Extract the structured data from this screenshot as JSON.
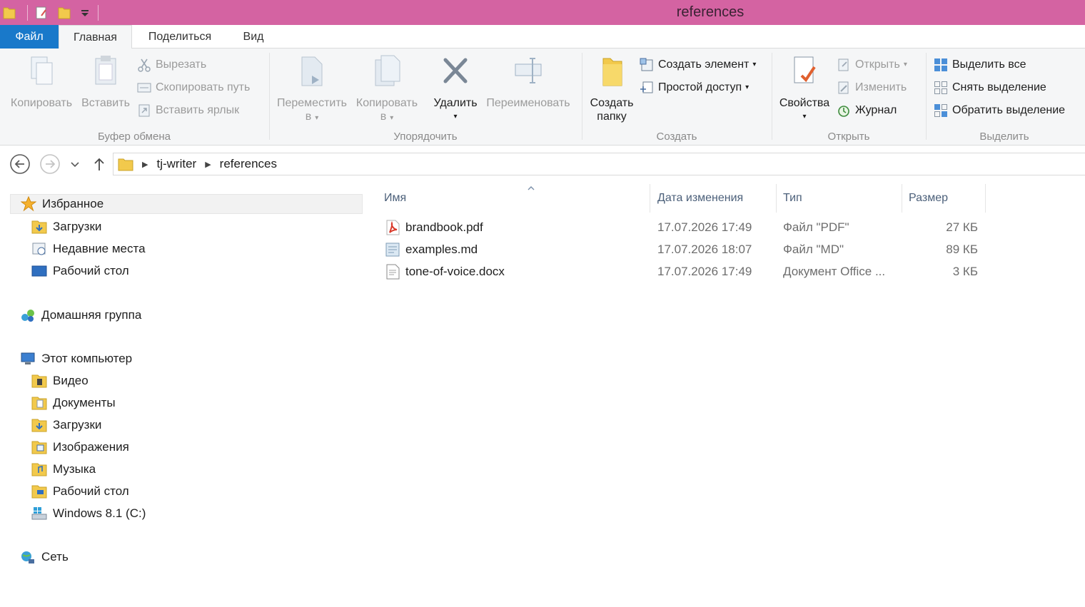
{
  "window": {
    "title": "references",
    "titlebar_color": "#d463a2"
  },
  "quick_access": {
    "icons": [
      "folder-icon",
      "properties-icon",
      "new-folder-icon",
      "customize-dropdown-icon"
    ]
  },
  "ribbon_tabs": {
    "file": "Файл",
    "home": "Главная",
    "share": "Поделиться",
    "view": "Вид"
  },
  "ribbon": {
    "clipboard": {
      "label": "Буфер обмена",
      "copy": "Копировать",
      "paste": "Вставить",
      "cut": "Вырезать",
      "copy_path": "Скопировать путь",
      "paste_shortcut": "Вставить ярлык"
    },
    "organize": {
      "label": "Упорядочить",
      "move_to_1": "Переместить",
      "move_to_2": "в",
      "copy_to_1": "Копировать",
      "copy_to_2": "в",
      "delete": "Удалить",
      "rename": "Переименовать"
    },
    "new": {
      "label": "Создать",
      "new_folder_1": "Создать",
      "new_folder_2": "папку",
      "new_item": "Создать элемент",
      "easy_access": "Простой доступ"
    },
    "open": {
      "label": "Открыть",
      "properties": "Свойства",
      "open": "Открыть",
      "edit": "Изменить",
      "history": "Журнал"
    },
    "select": {
      "label": "Выделить",
      "select_all": "Выделить все",
      "select_none": "Снять выделение",
      "invert": "Обратить выделение"
    }
  },
  "address_bar": {
    "crumbs": [
      "tj-writer",
      "references"
    ]
  },
  "nav_pane": {
    "favorites": "Избранное",
    "favorites_items": [
      "Загрузки",
      "Недавние места",
      "Рабочий стол"
    ],
    "homegroup": "Домашняя группа",
    "this_pc": "Этот компьютер",
    "this_pc_items": [
      "Видео",
      "Документы",
      "Загрузки",
      "Изображения",
      "Музыка",
      "Рабочий стол",
      "Windows 8.1 (C:)"
    ],
    "network": "Сеть"
  },
  "file_list": {
    "columns": [
      "Имя",
      "Дата изменения",
      "Тип",
      "Размер"
    ],
    "rows": [
      {
        "name": "brandbook.pdf",
        "modified": "17.07.2026 17:49",
        "type": "Файл \"PDF\"",
        "size": "27 КБ",
        "icon": "pdf-file-icon"
      },
      {
        "name": "examples.md",
        "modified": "17.07.2026 18:07",
        "type": "Файл \"MD\"",
        "size": "89 КБ",
        "icon": "md-file-icon"
      },
      {
        "name": "tone-of-voice.docx",
        "modified": "17.07.2026 17:49",
        "type": "Документ Office ...",
        "size": "3 КБ",
        "icon": "docx-file-icon"
      }
    ]
  }
}
